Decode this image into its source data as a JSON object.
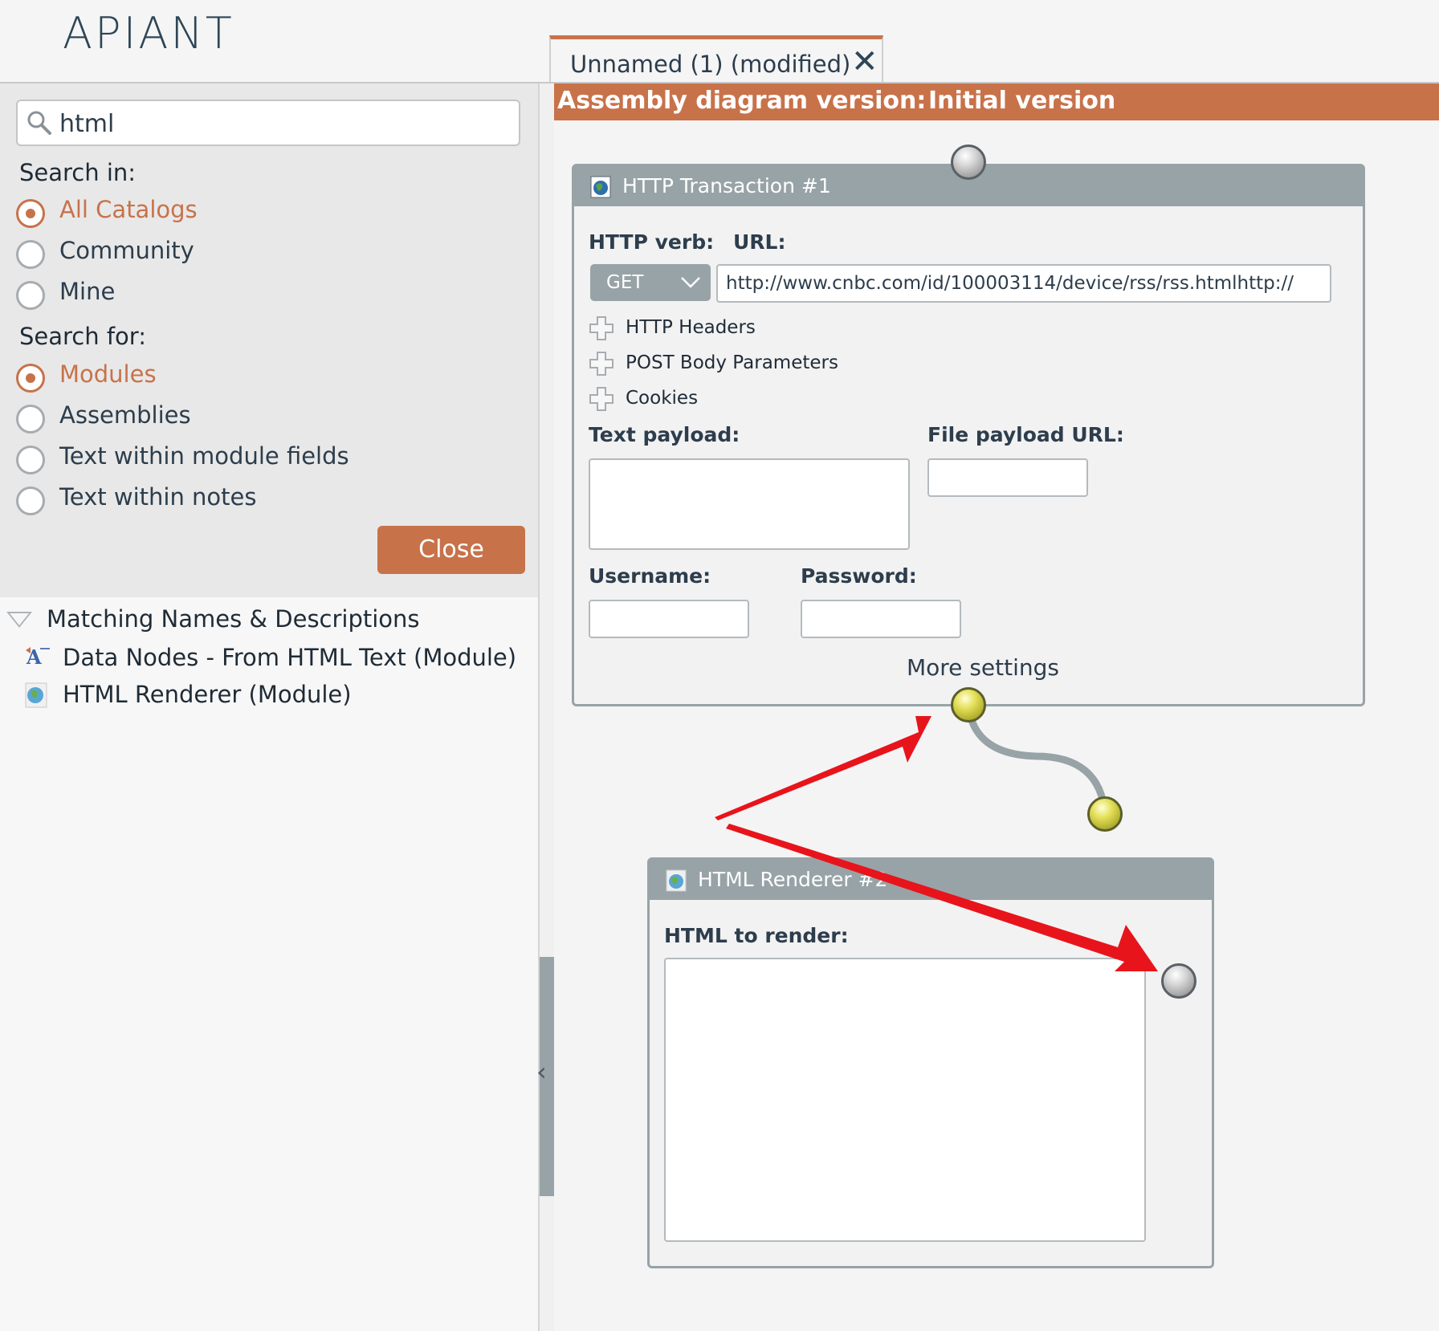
{
  "app": {
    "logo_text": "APIANT",
    "accent_color": "#c8724a",
    "slate_color": "#98a3a7"
  },
  "tab": {
    "label": "Unnamed (1) (modified)",
    "close_icon": "close-icon"
  },
  "search": {
    "value": "html",
    "icon": "search-icon"
  },
  "search_in": {
    "label": "Search in:",
    "options": [
      {
        "label": "All Catalogs",
        "selected": true
      },
      {
        "label": "Community",
        "selected": false
      },
      {
        "label": "Mine",
        "selected": false
      }
    ]
  },
  "search_for": {
    "label": "Search for:",
    "options": [
      {
        "label": "Modules",
        "selected": true
      },
      {
        "label": "Assemblies",
        "selected": false
      },
      {
        "label": "Text within module fields",
        "selected": false
      },
      {
        "label": "Text within notes",
        "selected": false
      }
    ]
  },
  "close_button": "Close",
  "results": {
    "header": "Matching Names & Descriptions",
    "items": [
      {
        "label": "Data Nodes - From HTML Text (Module)",
        "icon": "data-nodes-icon"
      },
      {
        "label": "HTML Renderer (Module)",
        "icon": "globe-icon"
      }
    ]
  },
  "version_bar": {
    "label": "Assembly diagram version:",
    "value": "Initial version"
  },
  "http_node": {
    "title": "HTTP Transaction #1",
    "verb_label": "HTTP verb:",
    "verb_value": "GET",
    "url_label": "URL:",
    "url_value": "http://www.cnbc.com/id/100003114/device/rss/rss.htmlhttp://",
    "expanders": [
      "HTTP Headers",
      "POST Body Parameters",
      "Cookies"
    ],
    "text_payload_label": "Text payload:",
    "file_payload_label": "File payload URL:",
    "username_label": "Username:",
    "password_label": "Password:",
    "more_settings": "More settings"
  },
  "renderer_node": {
    "title": "HTML Renderer #2",
    "html_label": "HTML to render:"
  }
}
